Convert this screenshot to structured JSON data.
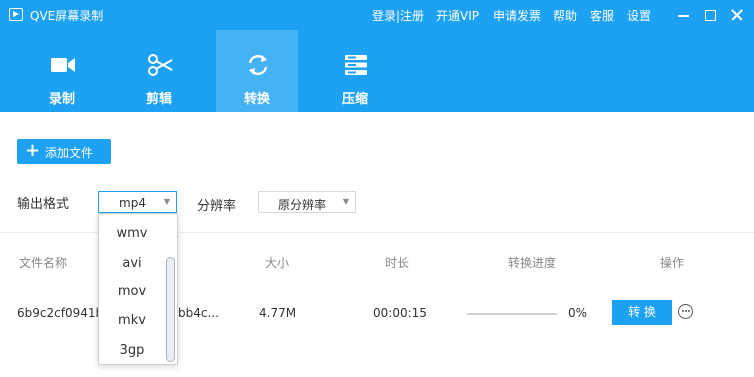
{
  "app": {
    "title": "QVE屏幕录制"
  },
  "top_links": [
    "登录|注册",
    "开通VIP",
    "申请发票",
    "帮助",
    "客服",
    "设置"
  ],
  "tabs": [
    {
      "label": "录制",
      "icon": "video-camera-icon"
    },
    {
      "label": "剪辑",
      "icon": "scissors-icon"
    },
    {
      "label": "转换",
      "icon": "convert-refresh-icon",
      "active": true
    },
    {
      "label": "压缩",
      "icon": "compress-icon"
    }
  ],
  "toolbar": {
    "add_file_label": "添加文件"
  },
  "format": {
    "label": "输出格式",
    "value": "mp4",
    "options": [
      "wmv",
      "avi",
      "mov",
      "mkv",
      "3gp"
    ]
  },
  "resolution": {
    "label": "分辨率",
    "value": "原分辨率"
  },
  "table": {
    "headers": [
      "文件名称",
      "大小",
      "时长",
      "转换进度",
      "操作"
    ],
    "rows": [
      {
        "name_left": "6b9c2cf0941b",
        "name_right": "bb4c...",
        "size": "4.77M",
        "duration": "00:00:15",
        "progress": "0%",
        "action": "转 换"
      }
    ]
  },
  "colors": {
    "brand": "#1da1f2"
  }
}
